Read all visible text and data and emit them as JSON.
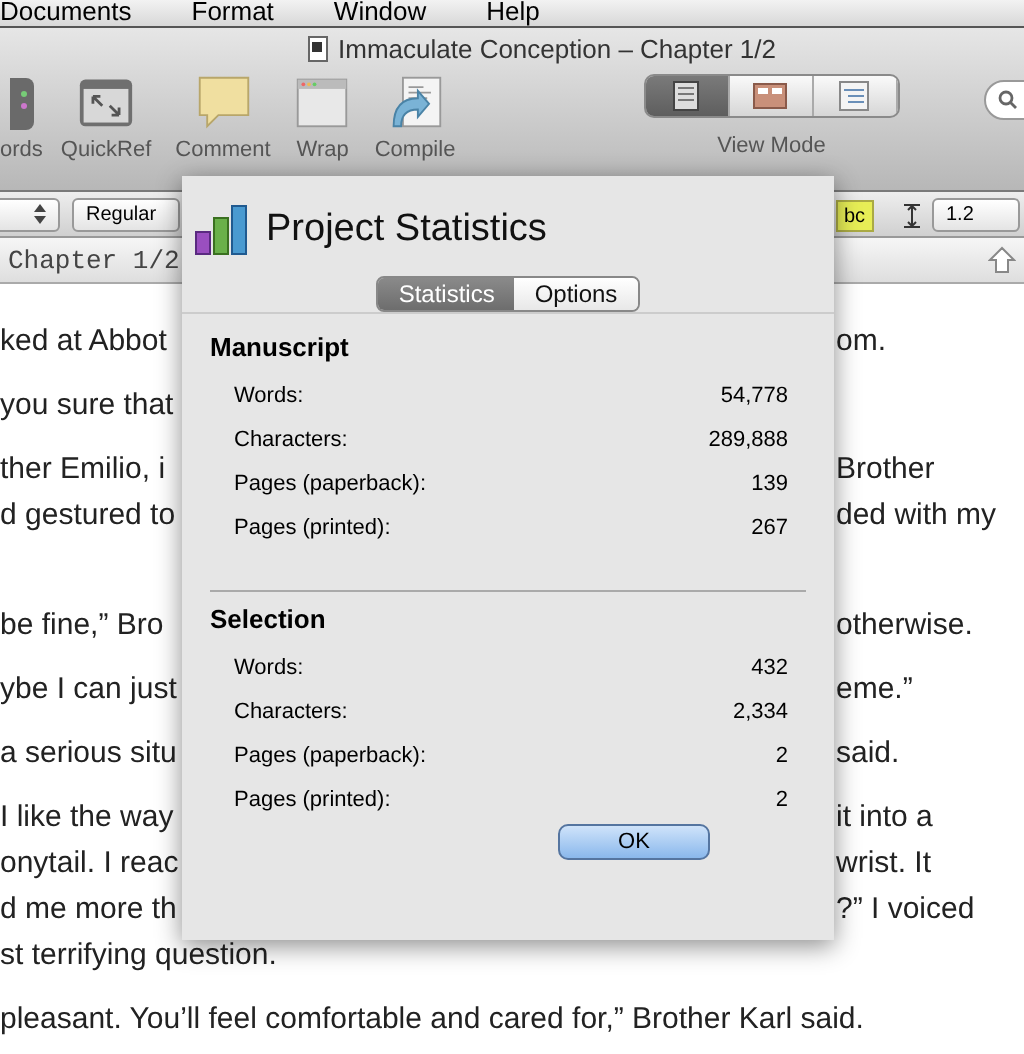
{
  "menu_bar": [
    "Documents",
    "Format",
    "Window",
    "Help"
  ],
  "window": {
    "title": "Immaculate Conception – Chapter 1/2"
  },
  "toolbar": [
    {
      "label": "ords",
      "kind": "keywords"
    },
    {
      "label": "QuickRef",
      "kind": "quickref"
    },
    {
      "label": "Comment",
      "kind": "comment"
    },
    {
      "label": "Wrap",
      "kind": "wrap"
    },
    {
      "label": "Compile",
      "kind": "compile"
    }
  ],
  "view_mode": {
    "label": "View Mode",
    "modes": [
      {
        "kind": "document",
        "selected": true
      },
      {
        "kind": "corkboard",
        "selected": false
      },
      {
        "kind": "outline",
        "selected": false
      }
    ]
  },
  "format_bar": {
    "font_style": "Regular",
    "highlight": "bc",
    "line_spacing": "1.2"
  },
  "header": {
    "title": "Chapter 1/2"
  },
  "document": [
    {
      "lines": [
        {
          "left": "ked at Abbot",
          "right": "om."
        }
      ]
    },
    {
      "lines": [
        {
          "left": "you sure that"
        }
      ]
    },
    {
      "lines": [
        {
          "left": "ther Emilio, i",
          "right": "Brother"
        },
        {
          "left": "d gestured to",
          "right": "ded with my"
        }
      ]
    },
    {
      "lines": [
        {
          "left": "be fine,” Bro",
          "right": "otherwise."
        }
      ]
    },
    {
      "lines": [
        {
          "left": "ybe I can just",
          "right": "eme.”"
        }
      ]
    },
    {
      "lines": [
        {
          "left": "a serious situ",
          "right": "said."
        }
      ]
    },
    {
      "lines": [
        {
          "left": "I like the way",
          "right": "it into a"
        },
        {
          "left": "onytail. I reac",
          "right": "wrist. It"
        },
        {
          "left": "d me more th",
          "right": "?” I voiced"
        },
        {
          "left": "st terrifying question."
        }
      ]
    },
    {
      "lines": [
        {
          "left": "pleasant. You’ll feel comfortable and cared for,” Brother Karl said."
        }
      ]
    }
  ],
  "dialog": {
    "title": "Project Statistics",
    "tabs": [
      {
        "label": "Statistics",
        "selected": true
      },
      {
        "label": "Options",
        "selected": false
      }
    ],
    "sections": [
      {
        "title": "Manuscript",
        "rows": [
          {
            "label": "Words:",
            "value": "54,778"
          },
          {
            "label": "Characters:",
            "value": "289,888"
          },
          {
            "label": "Pages (paperback):",
            "value": "139"
          },
          {
            "label": "Pages (printed):",
            "value": "267"
          }
        ]
      },
      {
        "title": "Selection",
        "rows": [
          {
            "label": "Words:",
            "value": "432"
          },
          {
            "label": "Characters:",
            "value": "2,334"
          },
          {
            "label": "Pages (paperback):",
            "value": "2"
          },
          {
            "label": "Pages (printed):",
            "value": "2"
          }
        ]
      }
    ],
    "button": "OK"
  }
}
